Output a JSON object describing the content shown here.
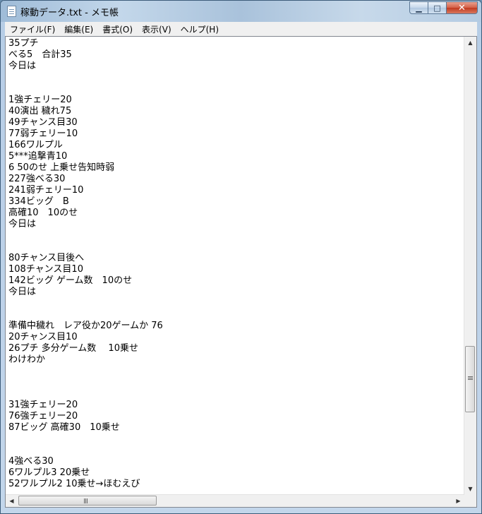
{
  "window": {
    "title": "稼動データ.txt - メモ帳"
  },
  "menu": [
    "ファイル(F)",
    "編集(E)",
    "書式(O)",
    "表示(V)",
    "ヘルプ(H)"
  ],
  "editor": {
    "lines": [
      "35プチ",
      "べる5　合計35",
      "今日は",
      "",
      "",
      "1強チェリー20",
      "40演出 穢れ75",
      "49チャンス目30",
      "77弱チェリー10",
      "166ワルプル",
      "5***追撃青10",
      "6 50のせ 上乗せ告知時弱",
      "227強べる30",
      "241弱チェリー10",
      "334ビッグ　B",
      "高確10　10のせ",
      "今日は",
      "",
      "",
      "80チャンス目後へ",
      "108チャンス目10",
      "142ビッグ ゲーム数　10のせ",
      "今日は",
      "",
      "",
      "準備中穢れ　レア役か20ゲームか 76",
      "20チャンス目10",
      "26プチ 多分ゲーム数　 10乗せ",
      "わけわか",
      "",
      "",
      "",
      "31強チェリー20",
      "76強チェリー20",
      "87ビッグ 高確30　10乗せ",
      "",
      "",
      "4強べる30",
      "6ワルプル3 20乗せ",
      "52ワルプル2 10乗せ→ほむえび"
    ]
  }
}
